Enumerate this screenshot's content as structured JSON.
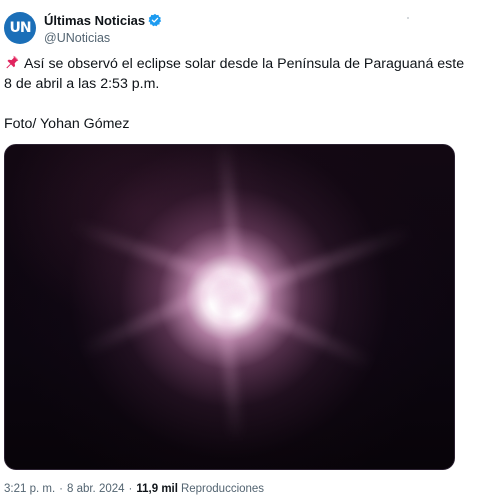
{
  "author": {
    "display_name": "Últimas Noticias",
    "handle": "@UNoticias",
    "avatar_text": "UN",
    "avatar_color": "#1b6fb8",
    "verified": true,
    "verified_color": "#1d9bf0"
  },
  "tweet": {
    "text": "Así se observó el eclipse solar desde la Península de Paraguaná este 8 de abril a las 2:53 p.m.",
    "credit": "Foto/ Yohan Gómez",
    "leading_icon": "pushpin-icon",
    "media": {
      "kind": "photo",
      "subject": "solar eclipse glare against dark sky"
    }
  },
  "meta": {
    "time": "3:21 p. m.",
    "separator": "·",
    "date": "8 abr. 2024",
    "views_count": "11,9 mil",
    "views_label": "Reproducciones"
  },
  "icons": {
    "more": "more-dots-icon",
    "verified": "verified-badge-icon"
  }
}
